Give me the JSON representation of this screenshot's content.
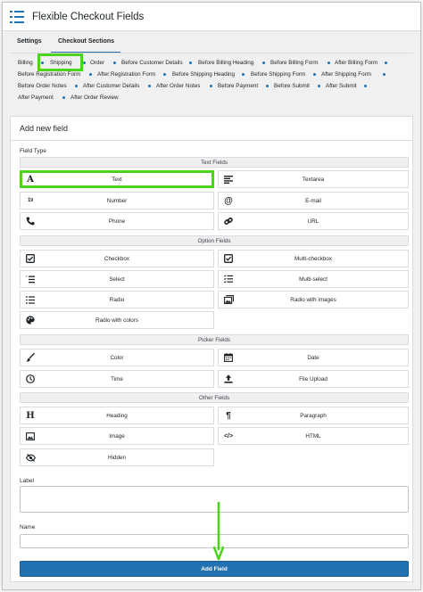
{
  "app": {
    "title": "Flexible Checkout Fields"
  },
  "tabs": [
    "Settings",
    "Checkout Sections"
  ],
  "sections": [
    [
      "Billing",
      "Shipping",
      "Order",
      "Before Customer Details",
      "Before Billing Heading",
      "Before Billing Form",
      "After Billing Form"
    ],
    [
      "Before Registration Form",
      "After Registration Form",
      "Before Shipping Heading",
      "Before Shipping Form",
      "After Shipping Form"
    ],
    [
      "Before Order Notes",
      "After Customer Details",
      "After Order Notes",
      "Before Payment",
      "Before Submit",
      "After Submit"
    ],
    [
      "After Payment",
      "After Order Review"
    ]
  ],
  "panel": {
    "title": "Add new field",
    "field_type_label": "Field Type",
    "groups": {
      "text": "Text Fields",
      "option": "Option Fields",
      "picker": "Picker Fields",
      "other": "Other Fields"
    },
    "fields": {
      "text": "Text",
      "textarea": "Textarea",
      "number": "Number",
      "email": "E-mail",
      "phone": "Phone",
      "url": "URL",
      "checkbox": "Checkbox",
      "multi_checkbox": "Multi-checkbox",
      "select": "Select",
      "multi_select": "Multi-select",
      "radio": "Radio",
      "radio_images": "Radio with images",
      "radio_colors": "Radio with colors",
      "color": "Color",
      "date": "Date",
      "time": "Time",
      "file_upload": "File Upload",
      "heading": "Heading",
      "paragraph": "Paragraph",
      "image": "Image",
      "html": "HTML",
      "hidden": "Hidden"
    },
    "label_label": "Label",
    "name_label": "Name",
    "add_button": "Add Field"
  },
  "colors": {
    "accent": "#2271b1",
    "highlight": "#4fd21e"
  },
  "icons": {
    "text": "A",
    "textarea": "☰",
    "number": "1/9",
    "email": "@",
    "phone": "✆",
    "url": "⚭",
    "heading": "H",
    "paragraph": "¶",
    "html": "</>"
  }
}
